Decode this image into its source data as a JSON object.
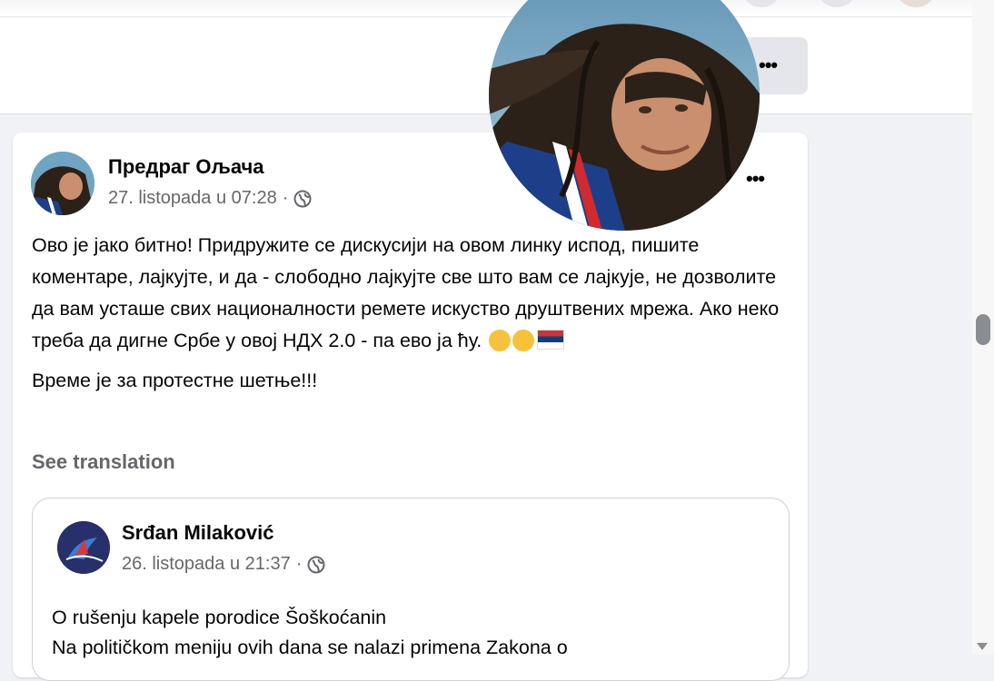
{
  "post": {
    "author": "Предраг Ољача",
    "timestamp": "27. listopada u 07:28",
    "separator": "·",
    "privacy_icon": "globe-icon",
    "body_paragraph_1": "Ово је јако битно! Придружите се дискусији на овом линку испод, пишите коментаре, лајкујте, и да - слободно лајкујте све што вам се лајкује, не дозволите да вам усташе свих националности ремете искуство друштвених мрежа. Ако неко треба да дигне Србе у овој НДХ 2.0 - па ево ја ћу.",
    "body_paragraph_1_emojis": [
      "smirk-emoji",
      "grin-emoji",
      "serbia-flag-emoji"
    ],
    "body_paragraph_2": "Време је за протестне шетње!!!",
    "see_translation": "See translation",
    "options_icon": "more-options-icon"
  },
  "shared_post": {
    "author": "Srđan Milaković",
    "timestamp": "26. listopada u 21:37",
    "separator": "·",
    "privacy_icon": "globe-icon",
    "line_1": "O rušenju kapele porodice Šoškoćanin",
    "line_2": "Na političkom meniju ovih dana se nalazi primena Zakona o"
  },
  "header": {
    "more_icon": "more-options-icon"
  },
  "colors": {
    "page_bg": "#f0f2f5",
    "card_bg": "#ffffff",
    "secondary_text": "#65676b",
    "button_bg": "#e4e6eb"
  }
}
